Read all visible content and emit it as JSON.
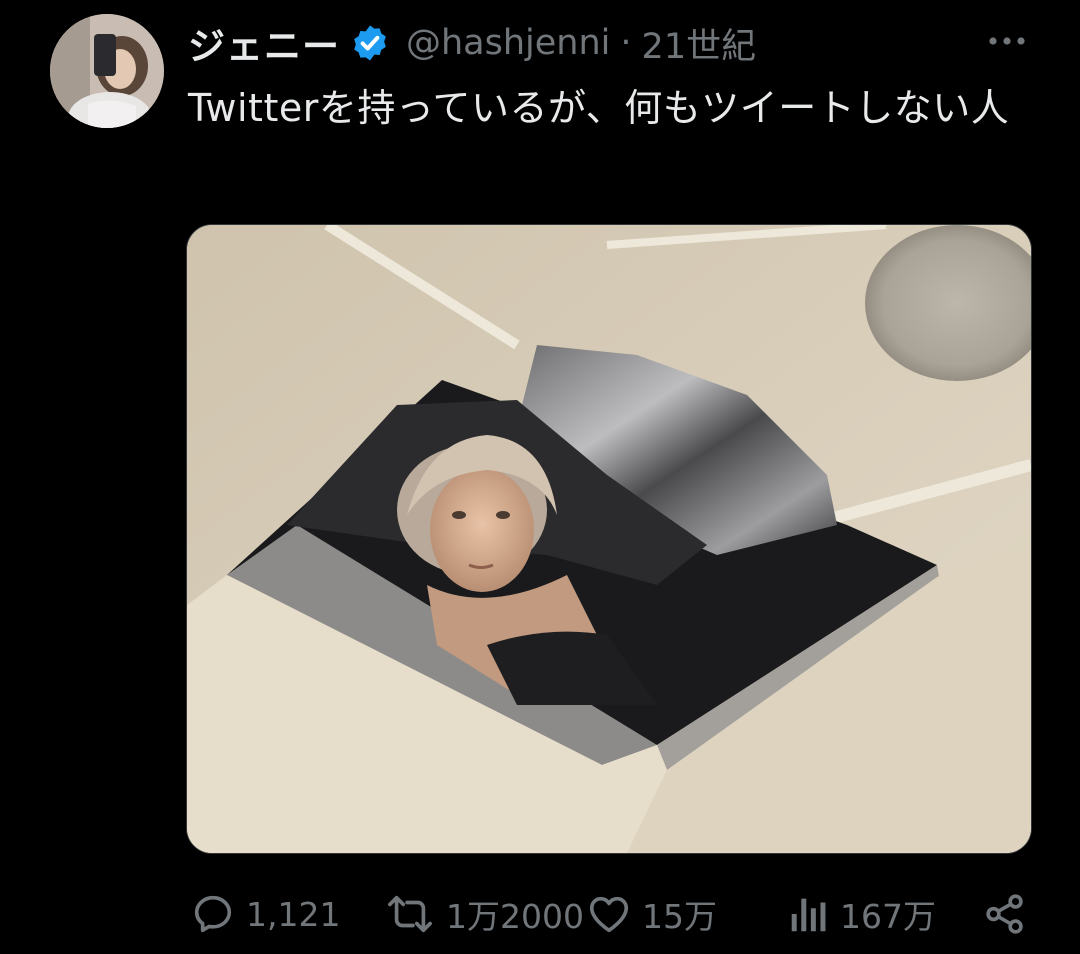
{
  "tweet": {
    "display_name": "ジェニー",
    "handle": "@hashjenni",
    "separator": "·",
    "timestamp": "21世紀",
    "text": "Twitterを持っているが、何もツイートしない人"
  },
  "actions": {
    "reply_count": "1,121",
    "retweet_count": "1万2000",
    "like_count": "15万",
    "view_count": "167万"
  },
  "colors": {
    "background": "#000000",
    "text_primary": "#e7e9ea",
    "text_secondary": "#71767b",
    "verified_blue": "#1d9bf0"
  },
  "icons": {
    "verified": "verified-badge-icon",
    "more": "more-dots-icon",
    "reply": "reply-icon",
    "retweet": "retweet-icon",
    "like": "heart-icon",
    "views": "views-chart-icon",
    "share": "share-icon"
  }
}
